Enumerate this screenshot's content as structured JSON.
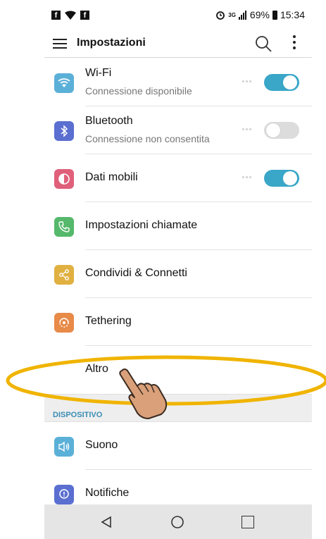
{
  "status_bar": {
    "left_icons": [
      "facebook-icon",
      "wifi-call-icon",
      "facebook-icon"
    ],
    "fb_glyph": "f",
    "battery_percent": "69%",
    "time": "15:34",
    "network": "3G"
  },
  "app_bar": {
    "title": "Impostazioni"
  },
  "settings": [
    {
      "title": "Wi-Fi",
      "subtitle": "Connessione disponibile",
      "icon": "wifi-icon",
      "color": "#5bb0d8",
      "toggle": true
    },
    {
      "title": "Bluetooth",
      "subtitle": "Connessione non consentita",
      "icon": "bluetooth-icon",
      "color": "#5a6fd0",
      "toggle": false
    },
    {
      "title": "Dati mobili",
      "icon": "mobile-data-icon",
      "color": "#e0607a",
      "toggle": true
    },
    {
      "title": "Impostazioni chiamate",
      "icon": "phone-icon",
      "color": "#55b86a"
    },
    {
      "title": "Condividi & Connetti",
      "icon": "share-icon",
      "color": "#e0b040"
    },
    {
      "title": "Tethering",
      "icon": "tethering-icon",
      "color": "#e88a48"
    },
    {
      "title": "Altro"
    }
  ],
  "section_dispositivo": "DISPOSITIVO",
  "device_items": [
    {
      "title": "Suono",
      "icon": "sound-icon",
      "color": "#5bb0d8"
    },
    {
      "title": "Notifiche",
      "icon": "notification-icon",
      "color": "#5a6fd0"
    }
  ],
  "colors": {
    "accent": "#3aa6c8",
    "section_text": "#3a8db5",
    "annotation": "#f0b400"
  }
}
